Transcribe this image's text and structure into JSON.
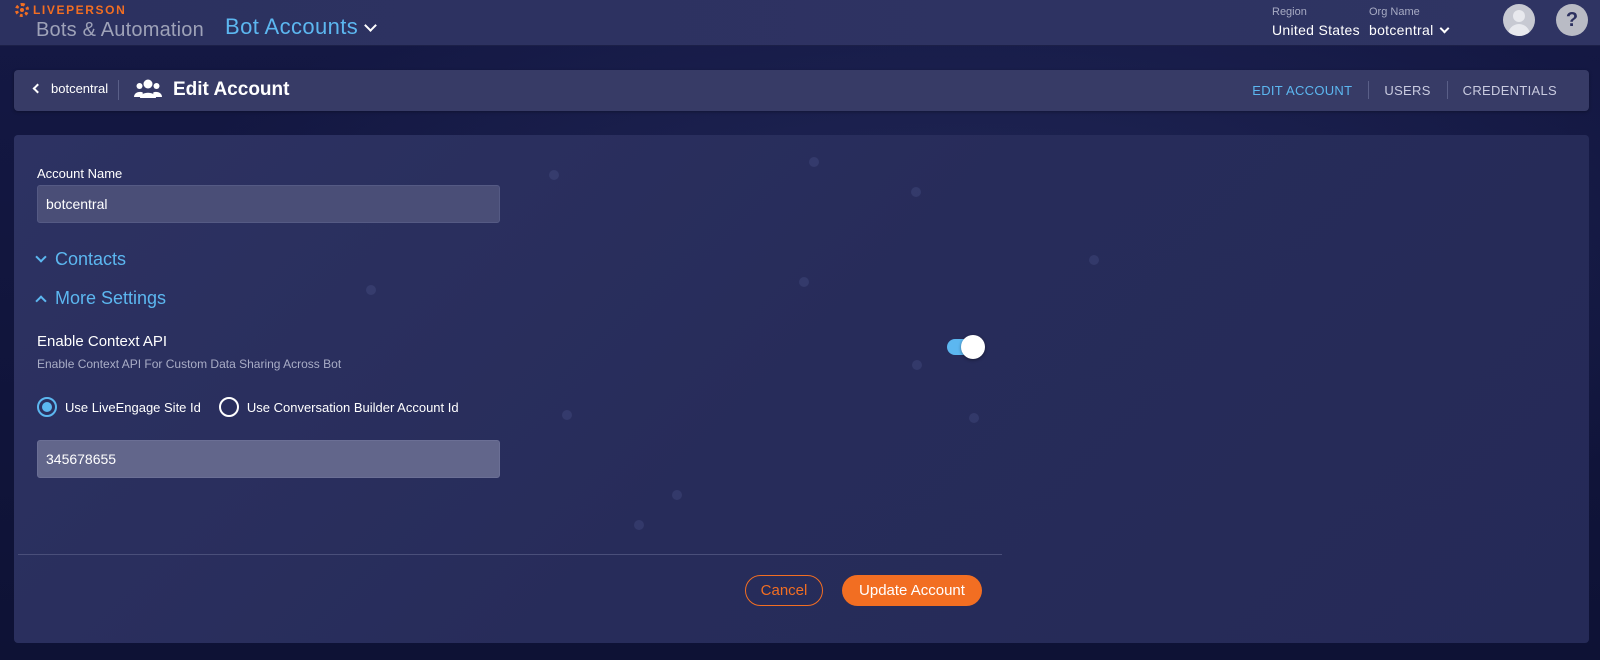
{
  "topbar": {
    "brand": "LIVEPERSON",
    "product": "Bots & Automation",
    "section": "Bot Accounts",
    "region_label": "Region",
    "region_value": "United States",
    "org_label": "Org Name",
    "org_value": "botcentral",
    "help_label": "?"
  },
  "header": {
    "back_label": "botcentral",
    "title": "Edit Account",
    "tabs": [
      {
        "label": "EDIT ACCOUNT",
        "active": true
      },
      {
        "label": "USERS",
        "active": false
      },
      {
        "label": "CREDENTIALS",
        "active": false
      }
    ]
  },
  "form": {
    "account_name_label": "Account Name",
    "account_name_value": "botcentral",
    "contacts_label": "Contacts",
    "more_settings_label": "More Settings",
    "context_api_title": "Enable Context API",
    "context_api_desc": "Enable Context API For Custom Data Sharing Across Bot",
    "context_api_enabled": true,
    "radio_options": [
      {
        "label": "Use LiveEngage Site Id",
        "selected": true
      },
      {
        "label": "Use Conversation Builder Account Id",
        "selected": false
      }
    ],
    "site_id_value": "345678655"
  },
  "actions": {
    "cancel_label": "Cancel",
    "update_label": "Update Account"
  },
  "colors": {
    "accent": "#5cb7f0",
    "brand_orange": "#f26e22",
    "background": "#0f1233"
  }
}
